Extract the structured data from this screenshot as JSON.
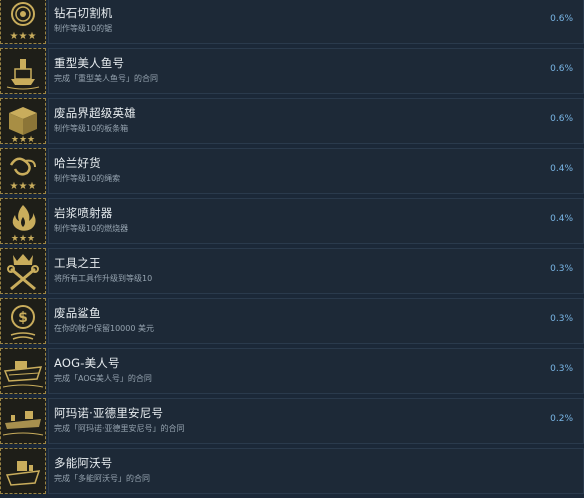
{
  "achievements": [
    {
      "name": "钻石切割机",
      "description": "制作等级10的锯",
      "percent": "0.6%",
      "icon": "saw-blade-icon"
    },
    {
      "name": "重型美人鱼号",
      "description": "完成「重型美人鱼号」的合同",
      "percent": "0.6%",
      "icon": "ship-icon"
    },
    {
      "name": "废品界超级英雄",
      "description": "制作等级10的板条箱",
      "percent": "0.6%",
      "icon": "crate-icon"
    },
    {
      "name": "哈兰好货",
      "description": "制作等级10的绳索",
      "percent": "0.4%",
      "icon": "rope-icon"
    },
    {
      "name": "岩浆喷射器",
      "description": "制作等级10的燃烧器",
      "percent": "0.4%",
      "icon": "flame-icon"
    },
    {
      "name": "工具之王",
      "description": "将所有工具作升级到等级10",
      "percent": "0.3%",
      "icon": "crown-tools-icon"
    },
    {
      "name": "废品鲨鱼",
      "description": "在你的帐户保留10000 美元",
      "percent": "0.3%",
      "icon": "dollar-coin-icon"
    },
    {
      "name": "AOG-美人号",
      "description": "完成「AOG美人号」的合同",
      "percent": "0.3%",
      "icon": "ship-icon"
    },
    {
      "name": "阿玛诺·亚德里安尼号",
      "description": "完成「阿玛诺·亚德里安尼号」的合同",
      "percent": "0.2%",
      "icon": "ship-icon"
    },
    {
      "name": "多能阿沃号",
      "description": "完成「多能阿沃号」的合同",
      "percent": "",
      "icon": "ship-icon"
    }
  ],
  "colors": {
    "background": "#1b2838",
    "icon_gold": "#c9ad5c",
    "percent_blue": "#79b6e6"
  }
}
